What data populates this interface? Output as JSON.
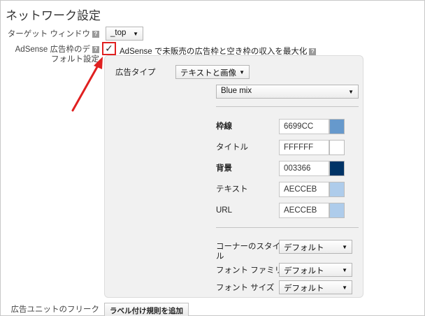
{
  "page_title": "ネットワーク設定",
  "target_window": {
    "label": "ターゲット ウィンドウ",
    "value": "_top"
  },
  "adsense_default": {
    "label_line1": "AdSense 広告枠のデ",
    "label_line2": "フォルト設定",
    "checkbox_checked": true,
    "checkbox_label": "AdSense で未販売の広告枠と空き枠の収入を最大化"
  },
  "panel": {
    "ad_type": {
      "label": "広告タイプ",
      "value": "テキストと画像"
    },
    "palette": {
      "value": "Blue mix"
    },
    "colors": [
      {
        "label": "枠線",
        "value": "6699CC",
        "hex": "#6699CC",
        "bold": true
      },
      {
        "label": "タイトル",
        "value": "FFFFFF",
        "hex": "#FFFFFF",
        "bold": false
      },
      {
        "label": "背景",
        "value": "003366",
        "hex": "#003366",
        "bold": true
      },
      {
        "label": "テキスト",
        "value": "AECCEB",
        "hex": "#AECCEB",
        "bold": false
      },
      {
        "label": "URL",
        "value": "AECCEB",
        "hex": "#AECCEB",
        "bold": false
      }
    ],
    "corner_style": {
      "label_line1": "コーナーのスタイ",
      "label_line2": "ル",
      "value": "デフォルト"
    },
    "font_family": {
      "label": "フォント ファミリー",
      "value": "デフォルト"
    },
    "font_size": {
      "label": "フォント サイズ",
      "value": "デフォルト"
    }
  },
  "freak": {
    "label": "広告ユニットのフリーク",
    "button_label": "ラベル付け規則を追加"
  },
  "help_glyph": "?",
  "caret_glyph": "▼",
  "check_glyph": "✓",
  "annotation_color": "#e02020"
}
